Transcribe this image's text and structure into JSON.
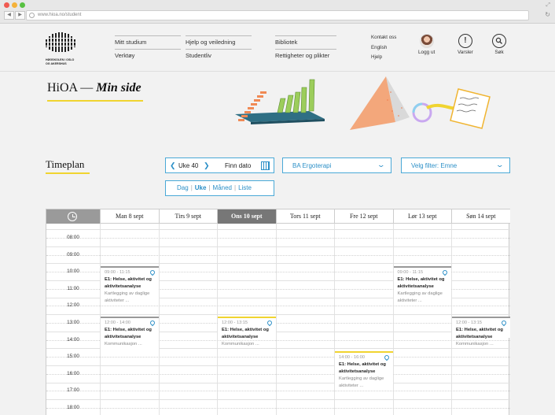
{
  "browser": {
    "url": "www.hioa.no/student"
  },
  "header": {
    "logo_text": "HØGSKOLEN I OSLO OG AKERSHUS",
    "nav_col1": [
      "Mitt studium",
      "Verktøy"
    ],
    "nav_col2": [
      "Hjelp og veiledning",
      "Studentliv"
    ],
    "nav_col3": [
      "Bibliotek",
      "Rettigheter og plikter"
    ],
    "util_links": [
      "Kontakt oss",
      "English",
      "Hjelp"
    ],
    "logout_label": "Logg ut",
    "alerts_label": "Varsler",
    "search_label": "Søk",
    "alerts_icon": "exclamation-icon",
    "search_icon": "magnifier-icon"
  },
  "hero": {
    "title": "HiOA —",
    "subtitle": "Min side"
  },
  "timeplan": {
    "title": "Timeplan",
    "week_label": "Uke 40",
    "find_date_label": "Finn dato",
    "program_select": "BA Ergoterapi",
    "filter_select": "Velg filter: Emne",
    "views": [
      "Dag",
      "Uke",
      "Måned",
      "Liste"
    ],
    "active_view": "Uke"
  },
  "calendar": {
    "days": [
      "Man 8 sept",
      "Tirs 9 sept",
      "Ons 10 sept",
      "Tors 11 sept",
      "Fre 12 sept",
      "Lør 13 sept",
      "Søn 14 sept"
    ],
    "today_index": 2,
    "times": [
      "08:00",
      "09:00",
      "10:00",
      "11:00",
      "12:00",
      "13:00",
      "14:00",
      "15:00",
      "16:00",
      "17:00",
      "18:00"
    ],
    "events": [
      {
        "day": 0,
        "time": "09:00 - 11:15",
        "title": "E1: Helse, aktivitet og aktivitetsanalyse",
        "desc": "Kartlegging av daglige aktiviteter ...",
        "highlight": false
      },
      {
        "day": 0,
        "time": "12:00 - 14:00",
        "title": "E1: Helse, aktivitet og aktivitetsanalyse",
        "desc": "Kommunikasjon ...",
        "highlight": false
      },
      {
        "day": 2,
        "time": "12:00 - 13:15",
        "title": "E1: Helse, aktivitet og aktivitetsanalyse",
        "desc": "Kommunikasjon ...",
        "highlight": true
      },
      {
        "day": 4,
        "time": "14:00 - 16:00",
        "title": "E1: Helse, aktivitet og aktivitetsanalyse",
        "desc": "Kartlegging av daglige aktiviteter ...",
        "highlight": true
      },
      {
        "day": 5,
        "time": "09:00 - 11:15",
        "title": "E1: Helse, aktivitet og aktivitetsanalyse",
        "desc": "Kartlegging av daglige aktiviteter ...",
        "highlight": false
      },
      {
        "day": 6,
        "time": "12:00 - 13:15",
        "title": "E1: Helse, aktivitet og aktivitetsanalyse",
        "desc": "Kommunikasjon ...",
        "highlight": false
      }
    ]
  }
}
